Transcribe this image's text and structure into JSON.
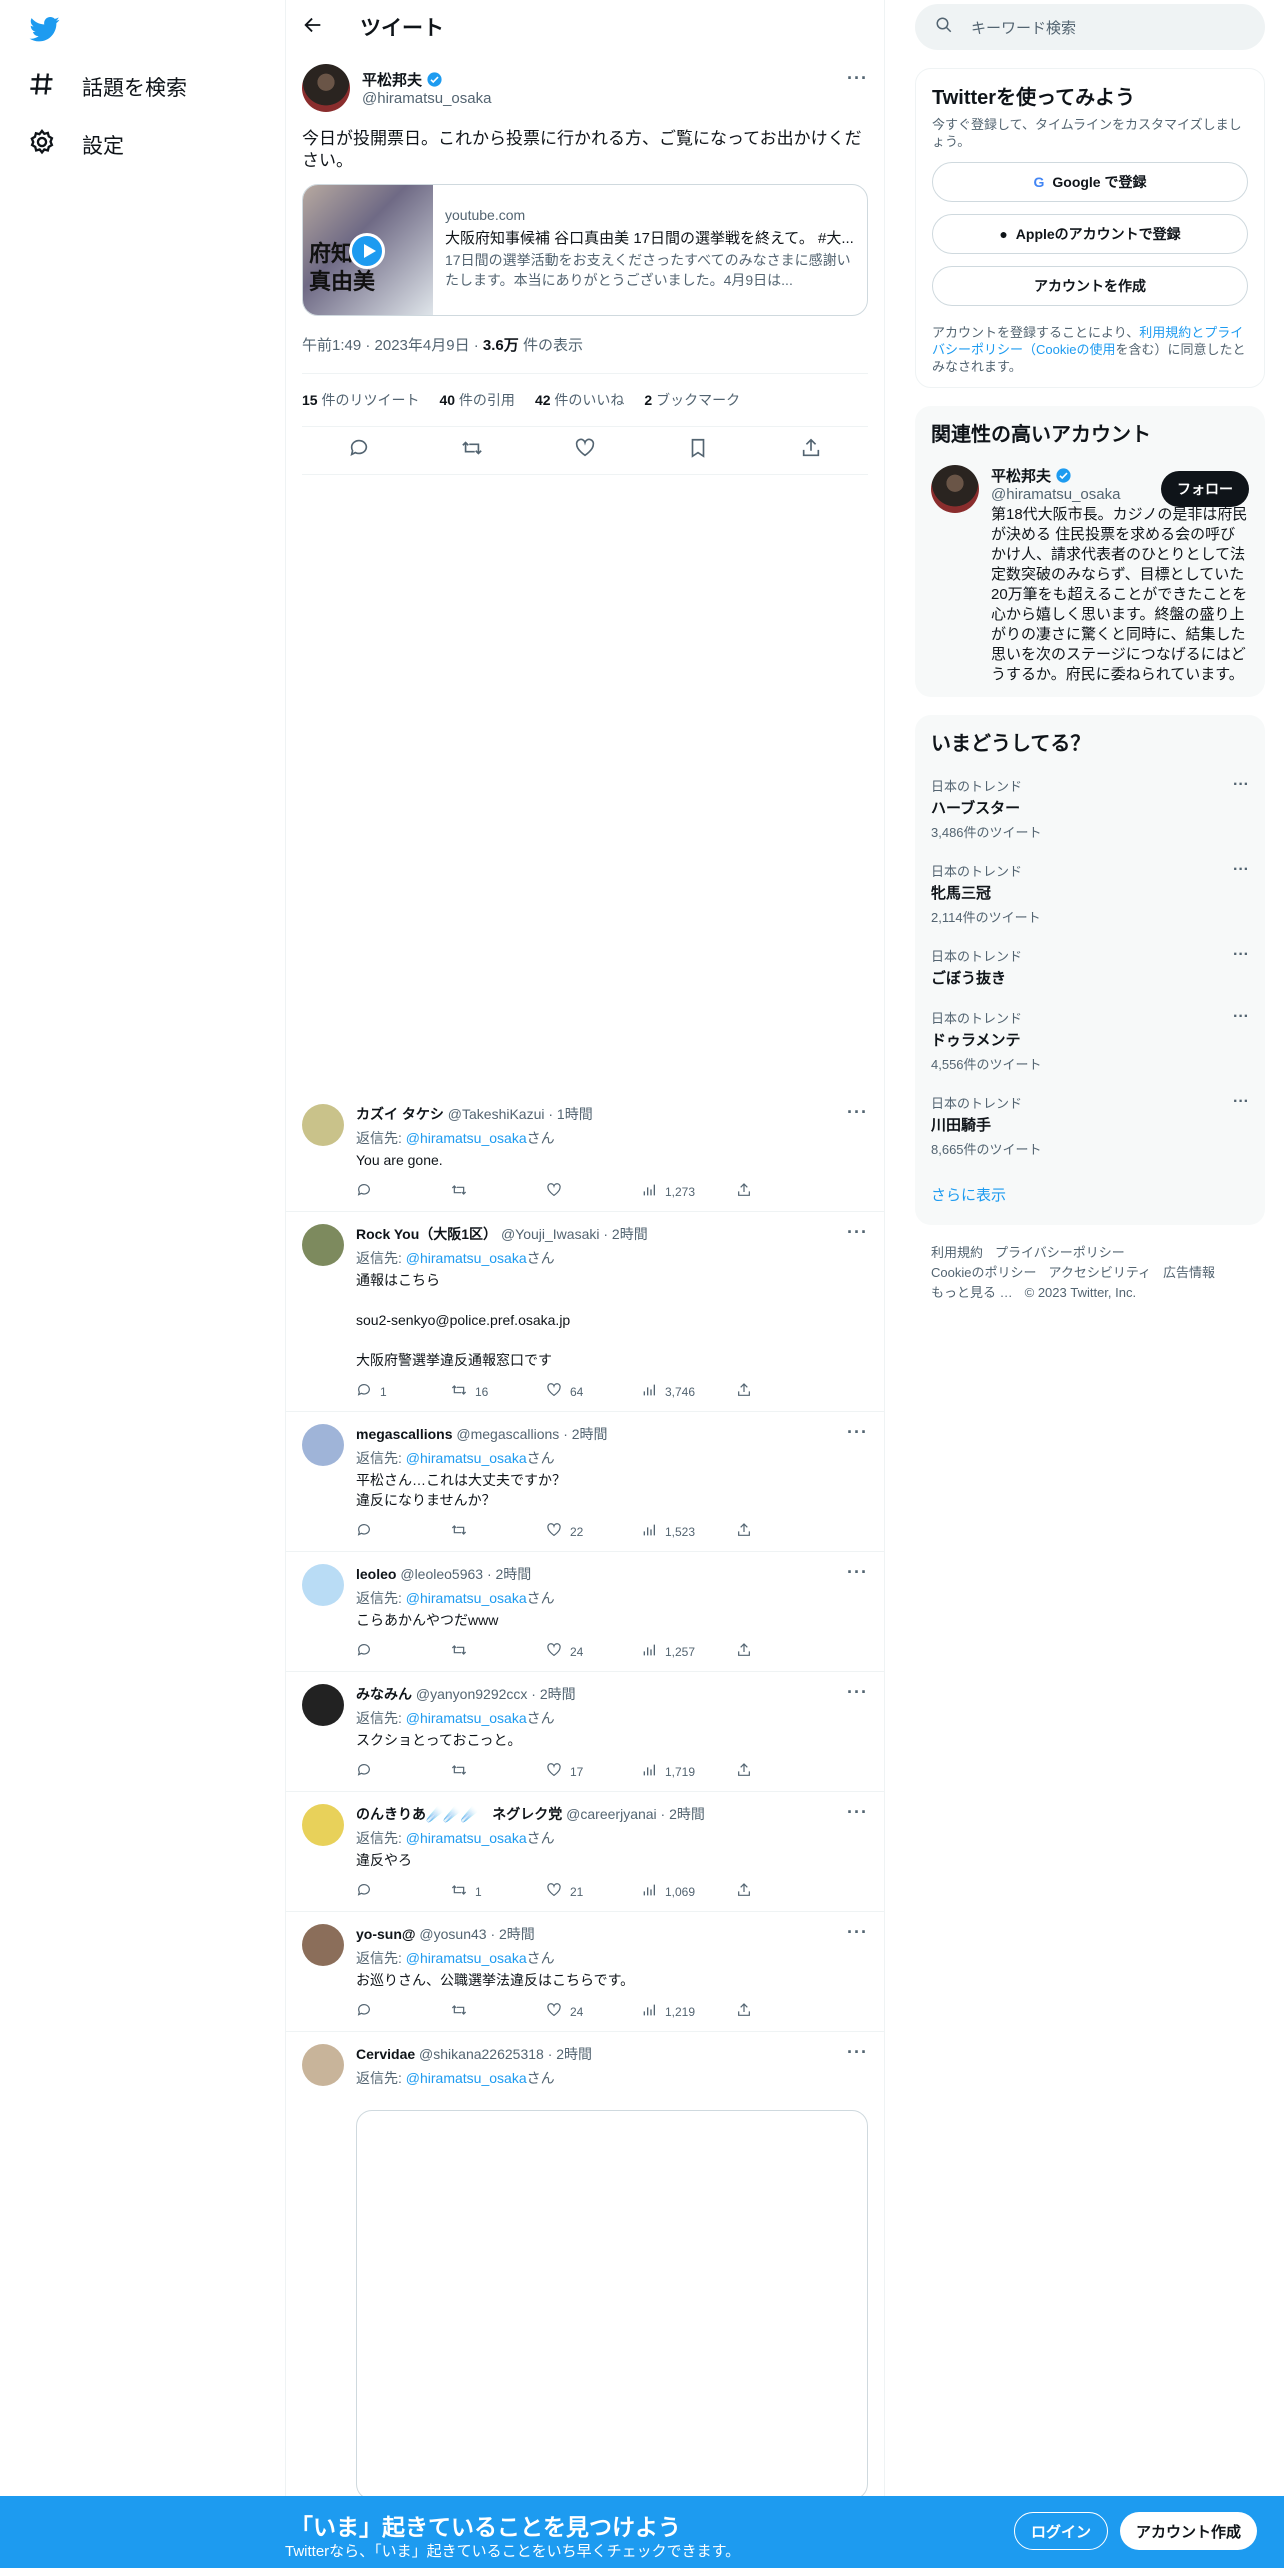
{
  "colors": {
    "accent": "#1d9bf0",
    "text": "#0f1419",
    "muted": "#536471",
    "border": "#eff3f4"
  },
  "nav": {
    "explore": "話題を検索",
    "settings": "設定"
  },
  "header": {
    "title": "ツイート"
  },
  "tweet": {
    "name": "平松邦夫",
    "handle": "@hiramatsu_osaka",
    "text": "今日が投開票日。これから投票に行かれる方、ご覧になってお出かけください。",
    "card": {
      "thumb_text_1": "府知",
      "thumb_text_2": "真由美",
      "domain": "youtube.com",
      "title": "大阪府知事候補 谷口真由美 17日間の選挙戦を終えて。 #大...",
      "desc": "17日間の選挙活動をお支えくださったすべてのみなさまに感謝いたします。本当にありがとうございました。4月9日は..."
    },
    "time": "午前1:49 · 2023年4月9日 · ",
    "views_num": "3.6万",
    "views_label": " 件の表示",
    "retweets": "15",
    "retweets_label": " 件のリツイート",
    "quotes": "40",
    "quotes_label": " 件の引用",
    "likes": "42",
    "likes_label": " 件のいいね",
    "bookmarks": "2",
    "bookmarks_label": " ブックマーク"
  },
  "reply_prefix": "返信先: ",
  "reply_handle": "@hiramatsu_osaka",
  "reply_suffix": "さん",
  "replies": [
    {
      "name": "カズイ タケシ",
      "meta": " @TakeshiKazui · 1時間",
      "text": "You are gone.",
      "reply": "",
      "rt": "",
      "like": "",
      "views": "1,273"
    },
    {
      "name": "Rock You（大阪1区）",
      "meta": " @Youji_Iwasaki · 2時間",
      "text": "通報はこちら\n\nsou2-senkyo@police.pref.osaka.jp\n\n大阪府警選挙違反通報窓口です",
      "reply": "1",
      "rt": "16",
      "like": "64",
      "views": "3,746"
    },
    {
      "name": "megascallions",
      "meta": " @megascallions · 2時間",
      "text": "平松さん…これは大丈夫ですか？\n違反になりませんか？",
      "reply": "",
      "rt": "",
      "like": "22",
      "views": "1,523"
    },
    {
      "name": "leoleo",
      "meta": " @leoleo5963 · 2時間",
      "text": "こらあかんやつだwww",
      "reply": "",
      "rt": "",
      "like": "24",
      "views": "1,257"
    },
    {
      "name": "みなみん",
      "meta": " @yanyon9292ccx · 2時間",
      "text": "スクショとっておこっと。",
      "reply": "",
      "rt": "",
      "like": "17",
      "views": "1,719"
    },
    {
      "name": "のんきりあ☄️☄️☄️　ネグレク党",
      "meta": " @careerjyanai · 2時間",
      "text": "違反やろ",
      "reply": "",
      "rt": "1",
      "like": "21",
      "views": "1,069"
    },
    {
      "name": "yo-sun@",
      "meta": " @yosun43 · 2時間",
      "text": "お巡りさん、公職選挙法違反はこちらです。",
      "reply": "",
      "rt": "",
      "like": "24",
      "views": "1,219"
    },
    {
      "name": "Cervidae",
      "meta": " @shikana22625318 · 2時間",
      "text": "",
      "reply": "",
      "rt": "",
      "like": "",
      "views": ""
    }
  ],
  "right": {
    "search_placeholder": "キーワード検索",
    "signup_title": "Twitterを使ってみよう",
    "signup_sub": "今すぐ登録して、タイムラインをカスタマイズしましょう。",
    "google_btn": "Google で登録",
    "apple_btn": "Appleのアカウントで登録",
    "create_btn": "アカウントを作成",
    "terms_1": "アカウントを登録することにより、",
    "terms_link": "利用規約とプライバシーポリシー（Cookieの使用",
    "terms_2": "を含む）に同意したとみなされます。",
    "related_title": "関連性の高いアカウント",
    "related_name": "平松邦夫",
    "related_handle": "@hiramatsu_osaka",
    "follow_btn": "フォロー",
    "related_bio": "第18代大阪市長。カジノの是非は府民が決める 住民投票を求める会の呼びかけ人、請求代表者のひとりとして法定数突破のみならず、目標としていた20万筆をも超えることができたことを心から嬉しく思います。終盤の盛り上がりの凄さに驚くと同時に、結集した思いを次のステージにつなげるにはどうするか。府民に委ねられています。",
    "trends_title": "いまどうしてる？",
    "trends": [
      {
        "loc": "日本のトレンド",
        "name": "ハーブスター",
        "count": "3,486件のツイート"
      },
      {
        "loc": "日本のトレンド",
        "name": "牝馬三冠",
        "count": "2,114件のツイート"
      },
      {
        "loc": "日本のトレンド",
        "name": "ごぼう抜き",
        "count": ""
      },
      {
        "loc": "日本のトレンド",
        "name": "ドゥラメンテ",
        "count": "4,556件のツイート"
      },
      {
        "loc": "日本のトレンド",
        "name": "川田騎手",
        "count": "8,665件のツイート"
      }
    ],
    "show_more": "さらに表示",
    "footer": [
      "利用規約",
      "プライバシーポリシー",
      "Cookieのポリシー",
      "アクセシビリティ",
      "広告情報",
      "もっと見る …",
      "© 2023 Twitter, Inc."
    ]
  },
  "bottom": {
    "title": "「いま」起きていることを見つけよう",
    "sub": "Twitterなら、「いま」起きていることをいち早くチェックできます。",
    "login": "ログイン",
    "signup": "アカウント作成"
  }
}
